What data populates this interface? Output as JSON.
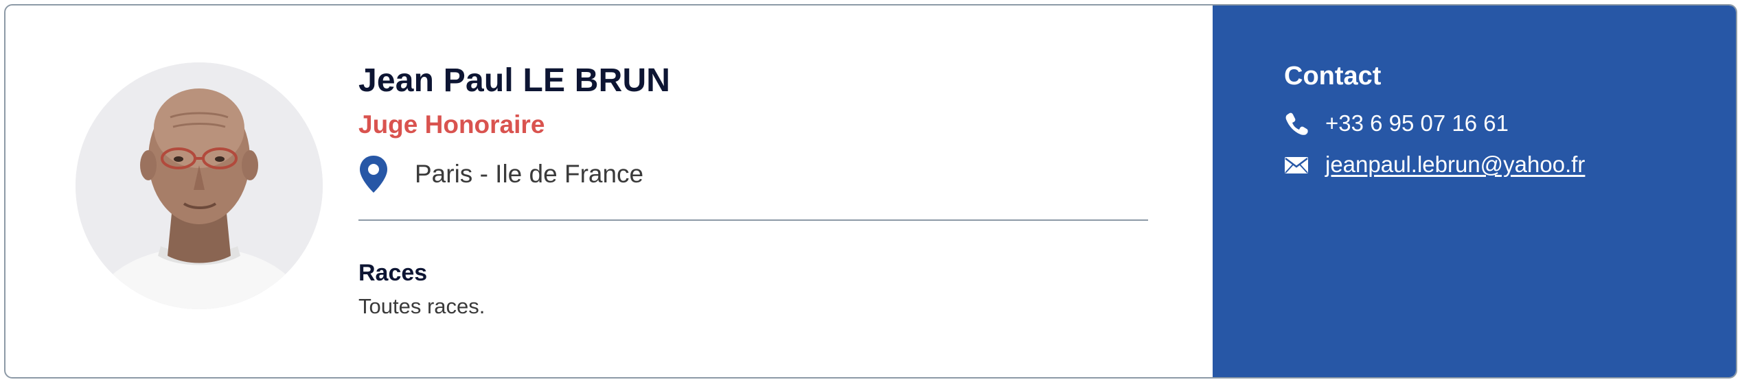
{
  "profile": {
    "name": "Jean Paul LE BRUN",
    "role": "Juge Honoraire",
    "location": "Paris - Ile de France",
    "photo_icon": "person-photo"
  },
  "races": {
    "title": "Races",
    "value": "Toutes races."
  },
  "contact": {
    "title": "Contact",
    "phone": "+33 6 95 07 16 61",
    "email": "jeanpaul.lebrun@yahoo.fr",
    "phone_icon": "phone-icon",
    "email_icon": "envelope-icon"
  },
  "colors": {
    "name": "#0d1533",
    "role": "#d9534f",
    "pin": "#2757a6",
    "panel": "#2757a6",
    "border": "#8c99a6"
  }
}
